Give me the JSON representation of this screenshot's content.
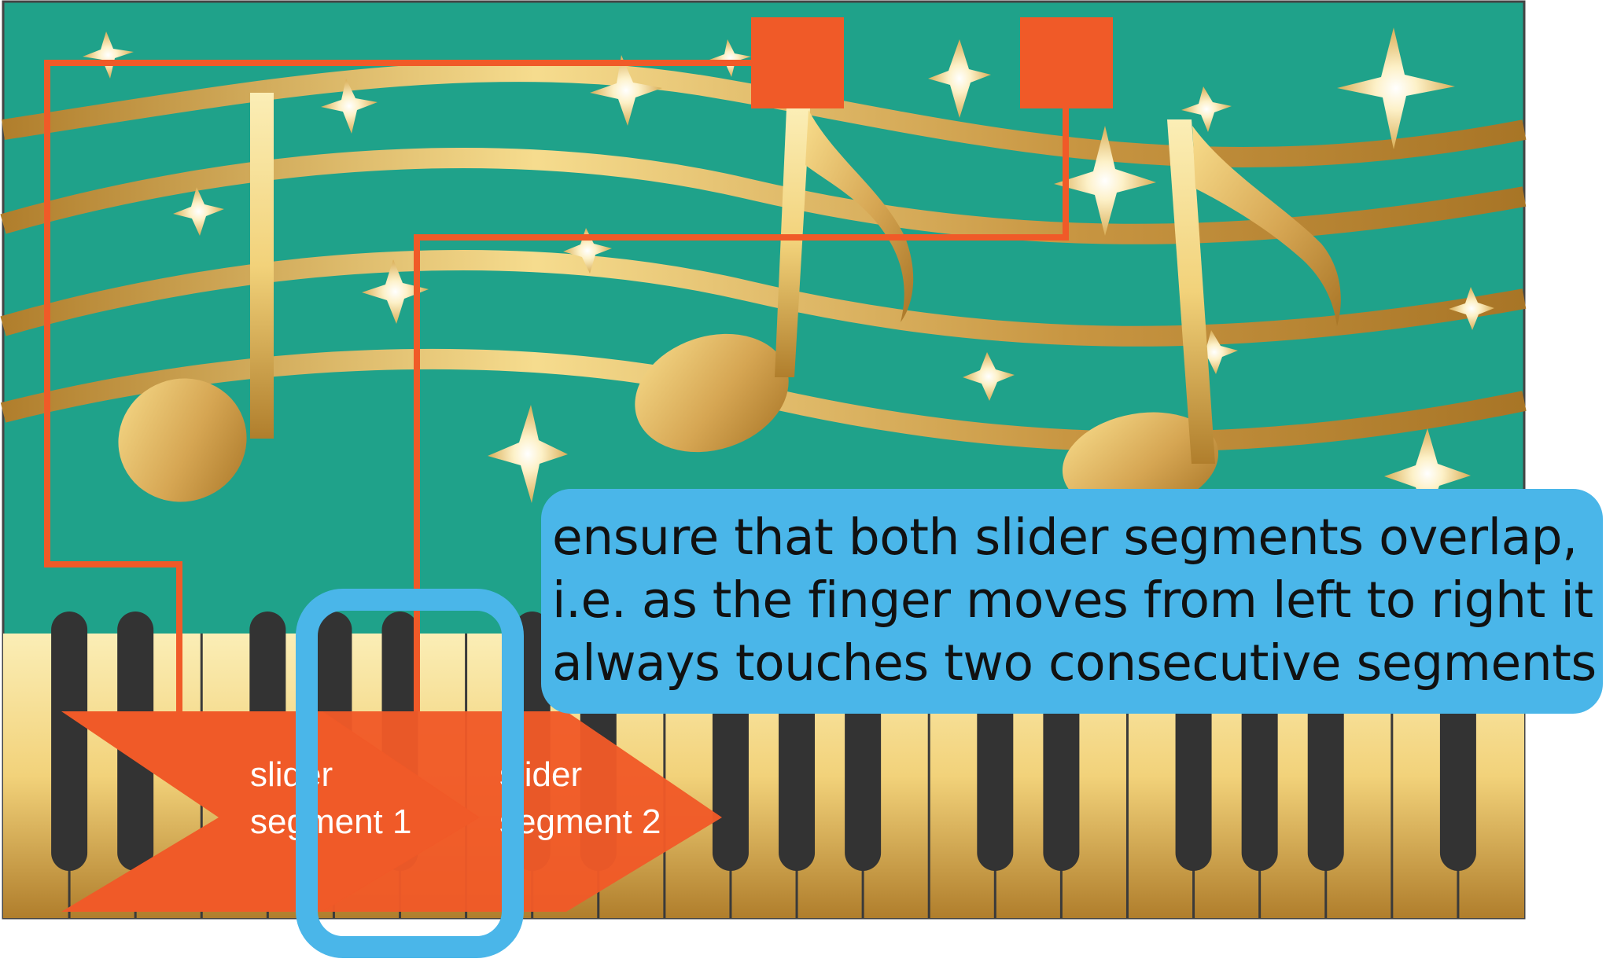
{
  "segments": [
    {
      "label_line1": "slider",
      "label_line2": "segment 1"
    },
    {
      "label_line1": "slider",
      "label_line2": "segment 2"
    }
  ],
  "callout": {
    "lines": [
      "ensure that both slider segments overlap,",
      "i.e. as the finger moves from left to right it",
      "always touches two consecutive segments"
    ]
  },
  "colors": {
    "background": "#1fa28a",
    "accent_orange": "#f05a28",
    "callout_blue": "#4ab6e9",
    "gold_light": "#f8dd8c",
    "gold_dark": "#b07e2c",
    "black_key": "#333333"
  }
}
